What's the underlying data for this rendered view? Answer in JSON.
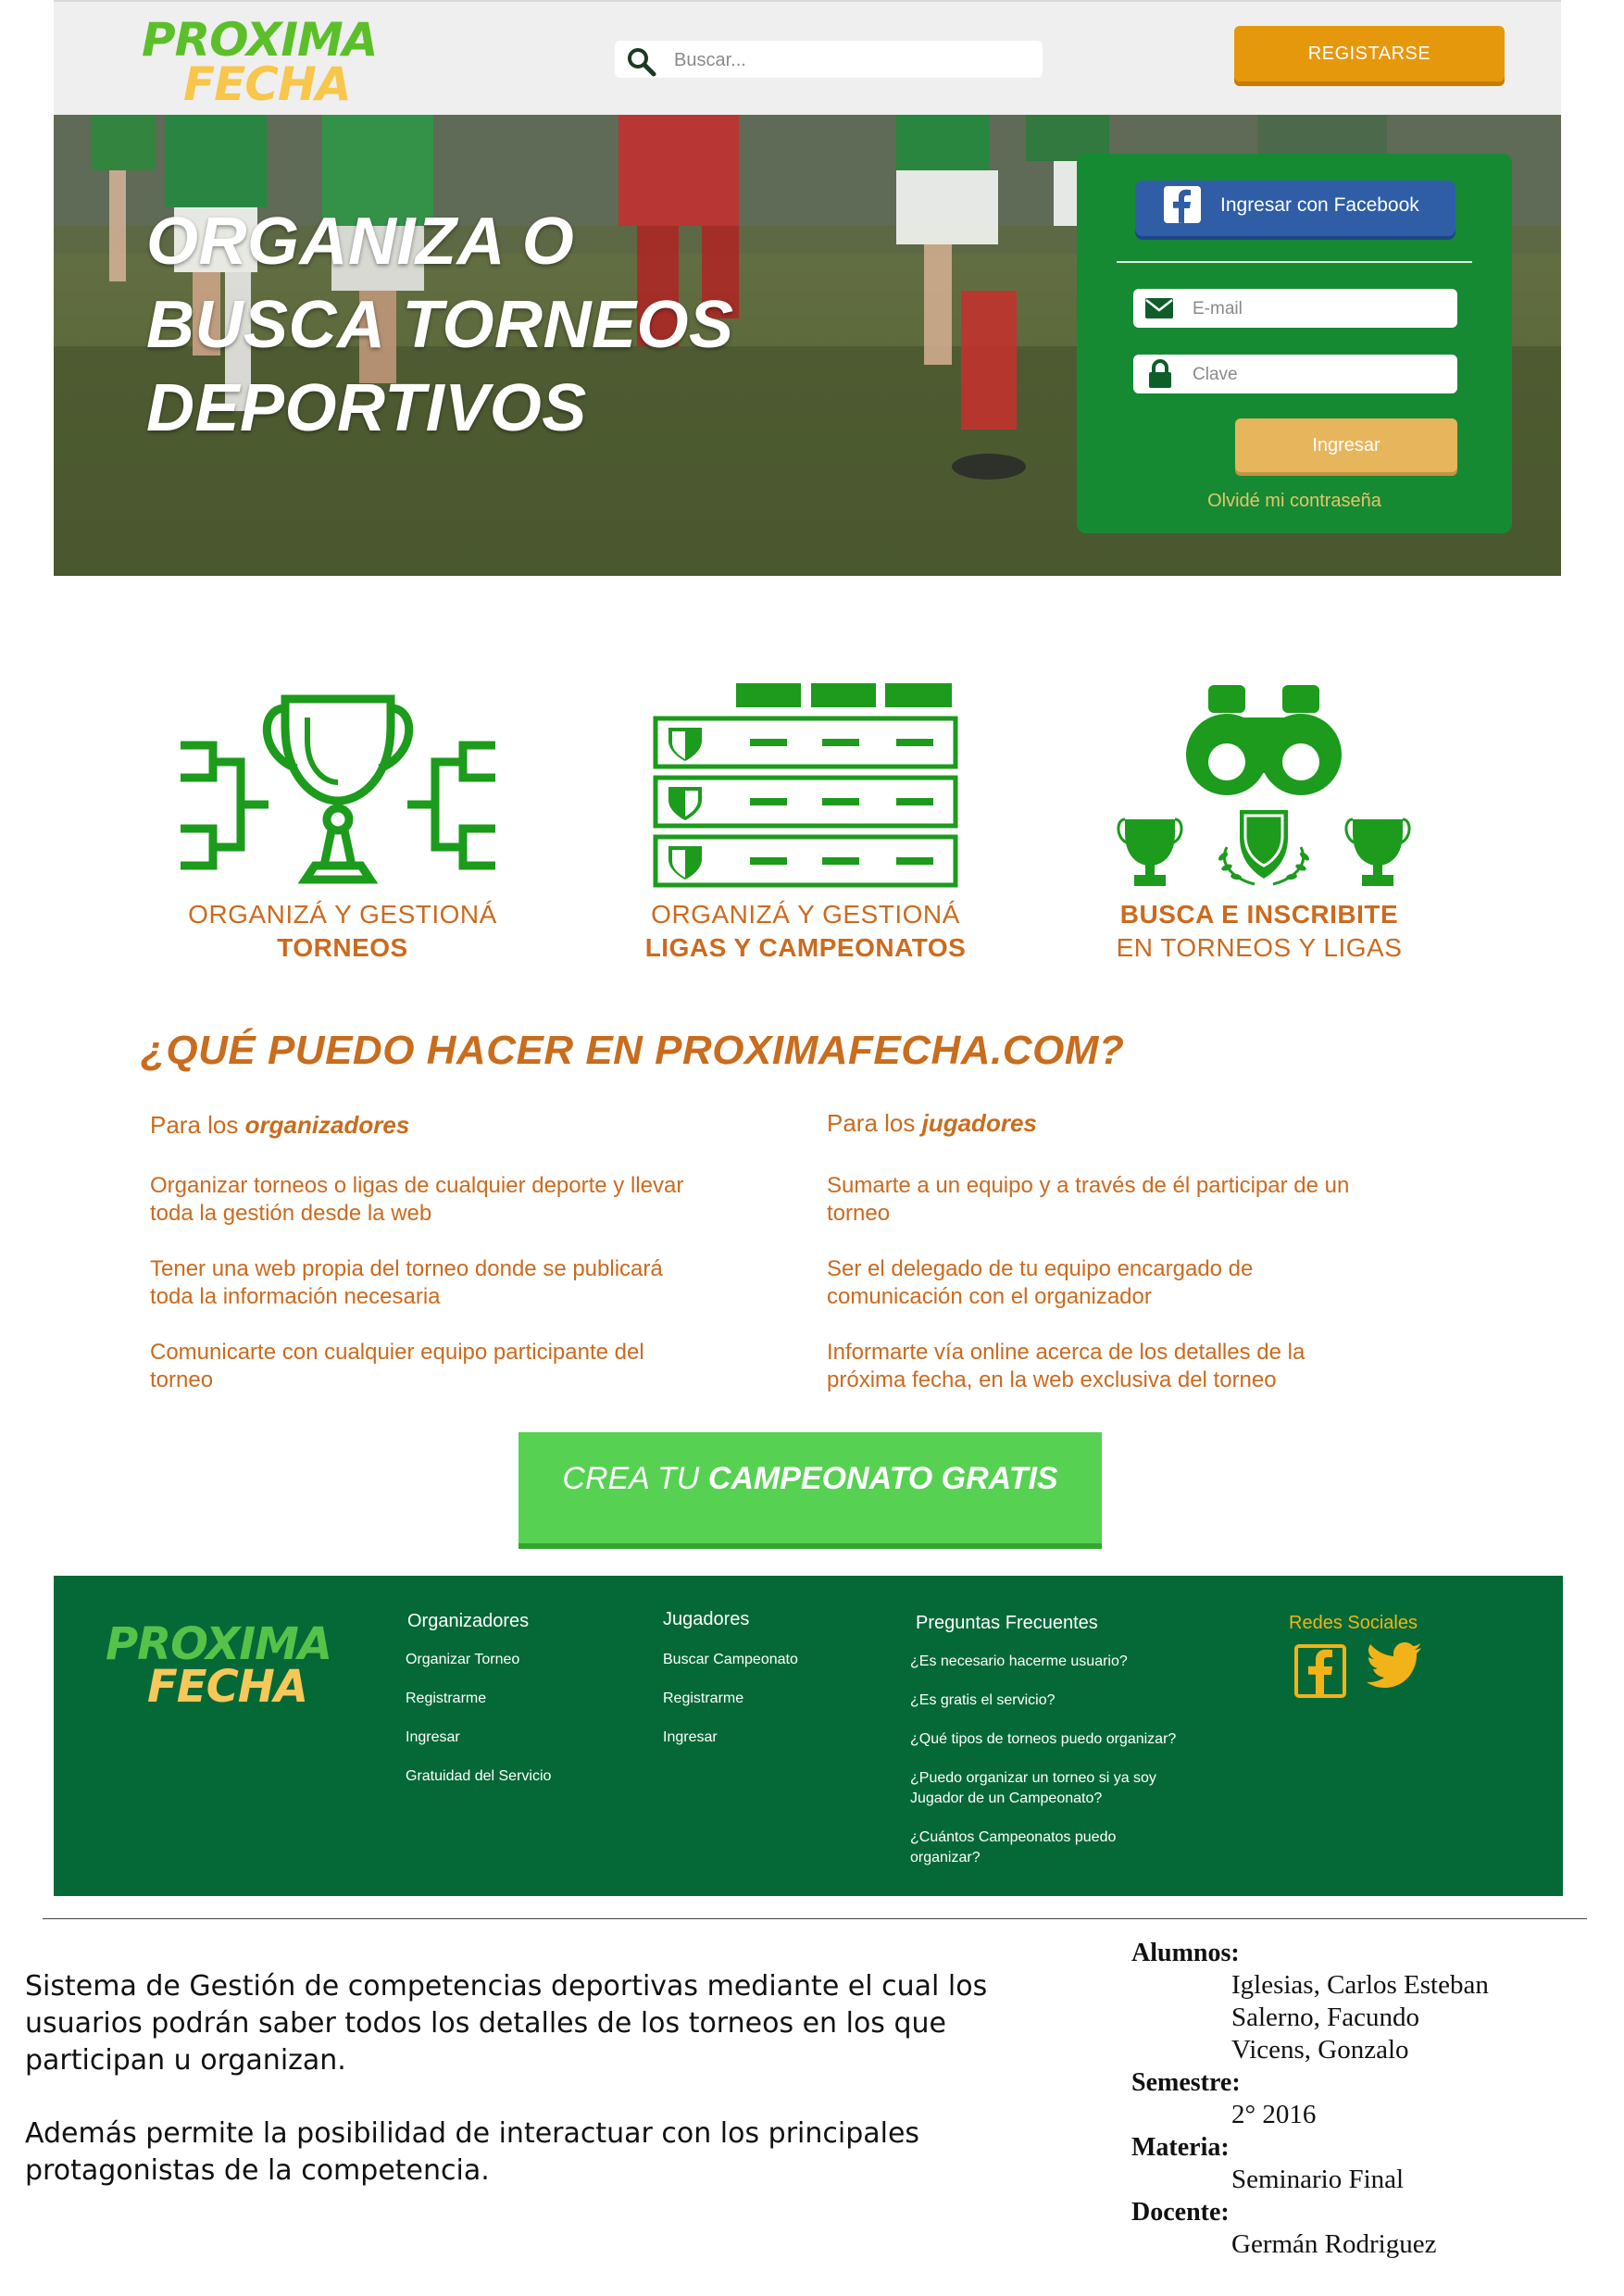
{
  "header": {
    "logo": {
      "line1": "PROXIMA",
      "line2": "FECHA"
    },
    "search": {
      "placeholder": "Buscar..."
    },
    "register_label": "REGISTARSE"
  },
  "hero": {
    "title_lines": [
      "ORGANIZA O",
      "BUSCA TORNEOS",
      "DEPORTIVOS"
    ]
  },
  "login": {
    "facebook_label": "Ingresar con Facebook",
    "email_placeholder": "E-mail",
    "password_placeholder": "Clave",
    "submit_label": "Ingresar",
    "forgot_label": "Olvidé mi contraseña"
  },
  "features": [
    {
      "line1": "ORGANIZÁ Y GESTIONÁ",
      "line2": "TORNEOS"
    },
    {
      "line1": "ORGANIZÁ Y GESTIONÁ",
      "line2": "LIGAS Y CAMPEONATOS"
    },
    {
      "line1": "BUSCA E INSCRIBITE",
      "line2": "EN TORNEOS Y LIGAS"
    }
  ],
  "what": {
    "heading": "¿QUÉ PUEDO HACER EN PROXIMAFECHA.COM?",
    "organizers": {
      "prefix": "Para los ",
      "emph": "organizadores",
      "items": [
        [
          "Organizar torneos o ligas de cualquier deporte y llevar",
          "toda la gestión desde la web"
        ],
        [
          "Tener una web propia del torneo donde se publicará",
          "toda la información necesaria"
        ],
        [
          "Comunicarte con cualquier equipo participante del",
          "torneo"
        ]
      ]
    },
    "players": {
      "prefix": "Para los ",
      "emph": "jugadores",
      "items": [
        [
          "Sumarte a un equipo y a través de él participar de un",
          "torneo"
        ],
        [
          "Ser el delegado de tu equipo encargado de",
          "comunicación con el organizador"
        ],
        [
          "Informarte vía online acerca de los detalles de la",
          "próxima fecha, en la web exclusiva del torneo"
        ]
      ]
    }
  },
  "cta": {
    "prefix": "CREA TU ",
    "emph": "CAMPEONATO GRATIS"
  },
  "footer": {
    "logo": {
      "line1": "PROXIMA",
      "line2": "FECHA"
    },
    "organizadores": {
      "title": "Organizadores",
      "links": [
        "Organizar Torneo",
        "Registrarme",
        "Ingresar",
        "Gratuidad del Servicio"
      ]
    },
    "jugadores": {
      "title": "Jugadores",
      "links": [
        "Buscar Campeonato",
        "Registrarme",
        "Ingresar"
      ]
    },
    "faq": {
      "title": "Preguntas Frecuentes",
      "links": [
        [
          "¿Es necesario hacerme usuario?"
        ],
        [
          "¿Es gratis el servicio?"
        ],
        [
          "¿Qué tipos de torneos puedo organizar?"
        ],
        [
          "¿Puedo organizar un torneo si ya soy",
          "Jugador de un Campeonato?"
        ],
        [
          "¿Cuántos Campeonatos puedo",
          "organizar?"
        ]
      ]
    },
    "social": {
      "title": "Redes Sociales",
      "icons": [
        "facebook-icon",
        "twitter-icon"
      ]
    }
  },
  "doc": {
    "description1": [
      "Sistema de Gestión de competencias deportivas mediante el cual los",
      "usuarios podrán saber todos los detalles de los torneos en los que",
      "participan u organizan."
    ],
    "description2": [
      "Además permite la posibilidad de interactuar con los principales",
      "protagonistas de la competencia."
    ],
    "alumnos_label": "Alumnos:",
    "alumnos": [
      "Iglesias, Carlos Esteban",
      "Salerno, Facundo",
      "Vicens, Gonzalo"
    ],
    "semestre_label": "Semestre:",
    "semestre": "2° 2016",
    "materia_label": "Materia:",
    "materia": "Seminario Final",
    "docente_label": "Docente:",
    "docente": "Germán Rodriguez"
  },
  "colors": {
    "green": "#158a33",
    "footer_green": "#056937",
    "orange": "#cc6a1e",
    "cta_green": "#57d152",
    "register_orange": "#e6980d"
  }
}
